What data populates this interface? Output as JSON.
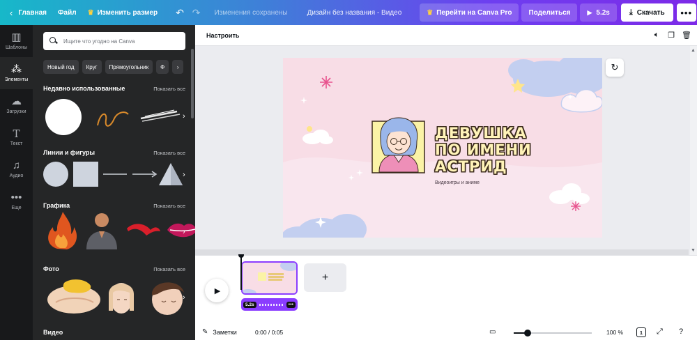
{
  "topbar": {
    "home": "Главная",
    "file": "Файл",
    "resize": "Изменить размер",
    "saved_status": "Изменения сохранены",
    "design_title": "Дизайн без названия - Видео",
    "pro": "Перейти на Canva Pro",
    "share": "Поделиться",
    "duration": "5.2s",
    "download": "Скачать"
  },
  "rail": {
    "items": [
      {
        "label": "Шаблоны",
        "icon": "templates-icon"
      },
      {
        "label": "Элементы",
        "icon": "elements-icon"
      },
      {
        "label": "Загрузки",
        "icon": "uploads-icon"
      },
      {
        "label": "Текст",
        "icon": "text-icon"
      },
      {
        "label": "Аудио",
        "icon": "audio-icon"
      },
      {
        "label": "Еще",
        "icon": "more-icon"
      }
    ]
  },
  "panel": {
    "search_placeholder": "Ищите что угодно на Canva",
    "chips": [
      "Новый год",
      "Круг",
      "Прямоугольник",
      "Ф"
    ],
    "sections": [
      {
        "title": "Недавно использованные",
        "link": "Показать все"
      },
      {
        "title": "Линии и фигуры",
        "link": "Показать все"
      },
      {
        "title": "Графика",
        "link": "Показать все"
      },
      {
        "title": "Фото",
        "link": "Показать все"
      },
      {
        "title": "Видео",
        "link": ""
      }
    ]
  },
  "editor": {
    "adjust": "Настроить"
  },
  "design": {
    "title_lines": [
      "ДЕВУШКА",
      "ПО ИМЕНИ",
      "АСТРИД"
    ],
    "subtitle": "Видеоигры и аниме",
    "colors": {
      "background": "#f8dde6",
      "title_fill": "#fff3b8",
      "title_outline": "#3a2a1c",
      "cloud": "#c3cff0"
    }
  },
  "timeline": {
    "clip_duration": "5.2s"
  },
  "footer": {
    "notes": "Заметки",
    "time": "0:00 / 0:05",
    "zoom": "100 %",
    "zoom_fraction": 0.18,
    "page_count": "1"
  },
  "colors": {
    "accent": "#8b3dff",
    "rail_bg": "#18191b",
    "panel_bg": "#252627"
  }
}
